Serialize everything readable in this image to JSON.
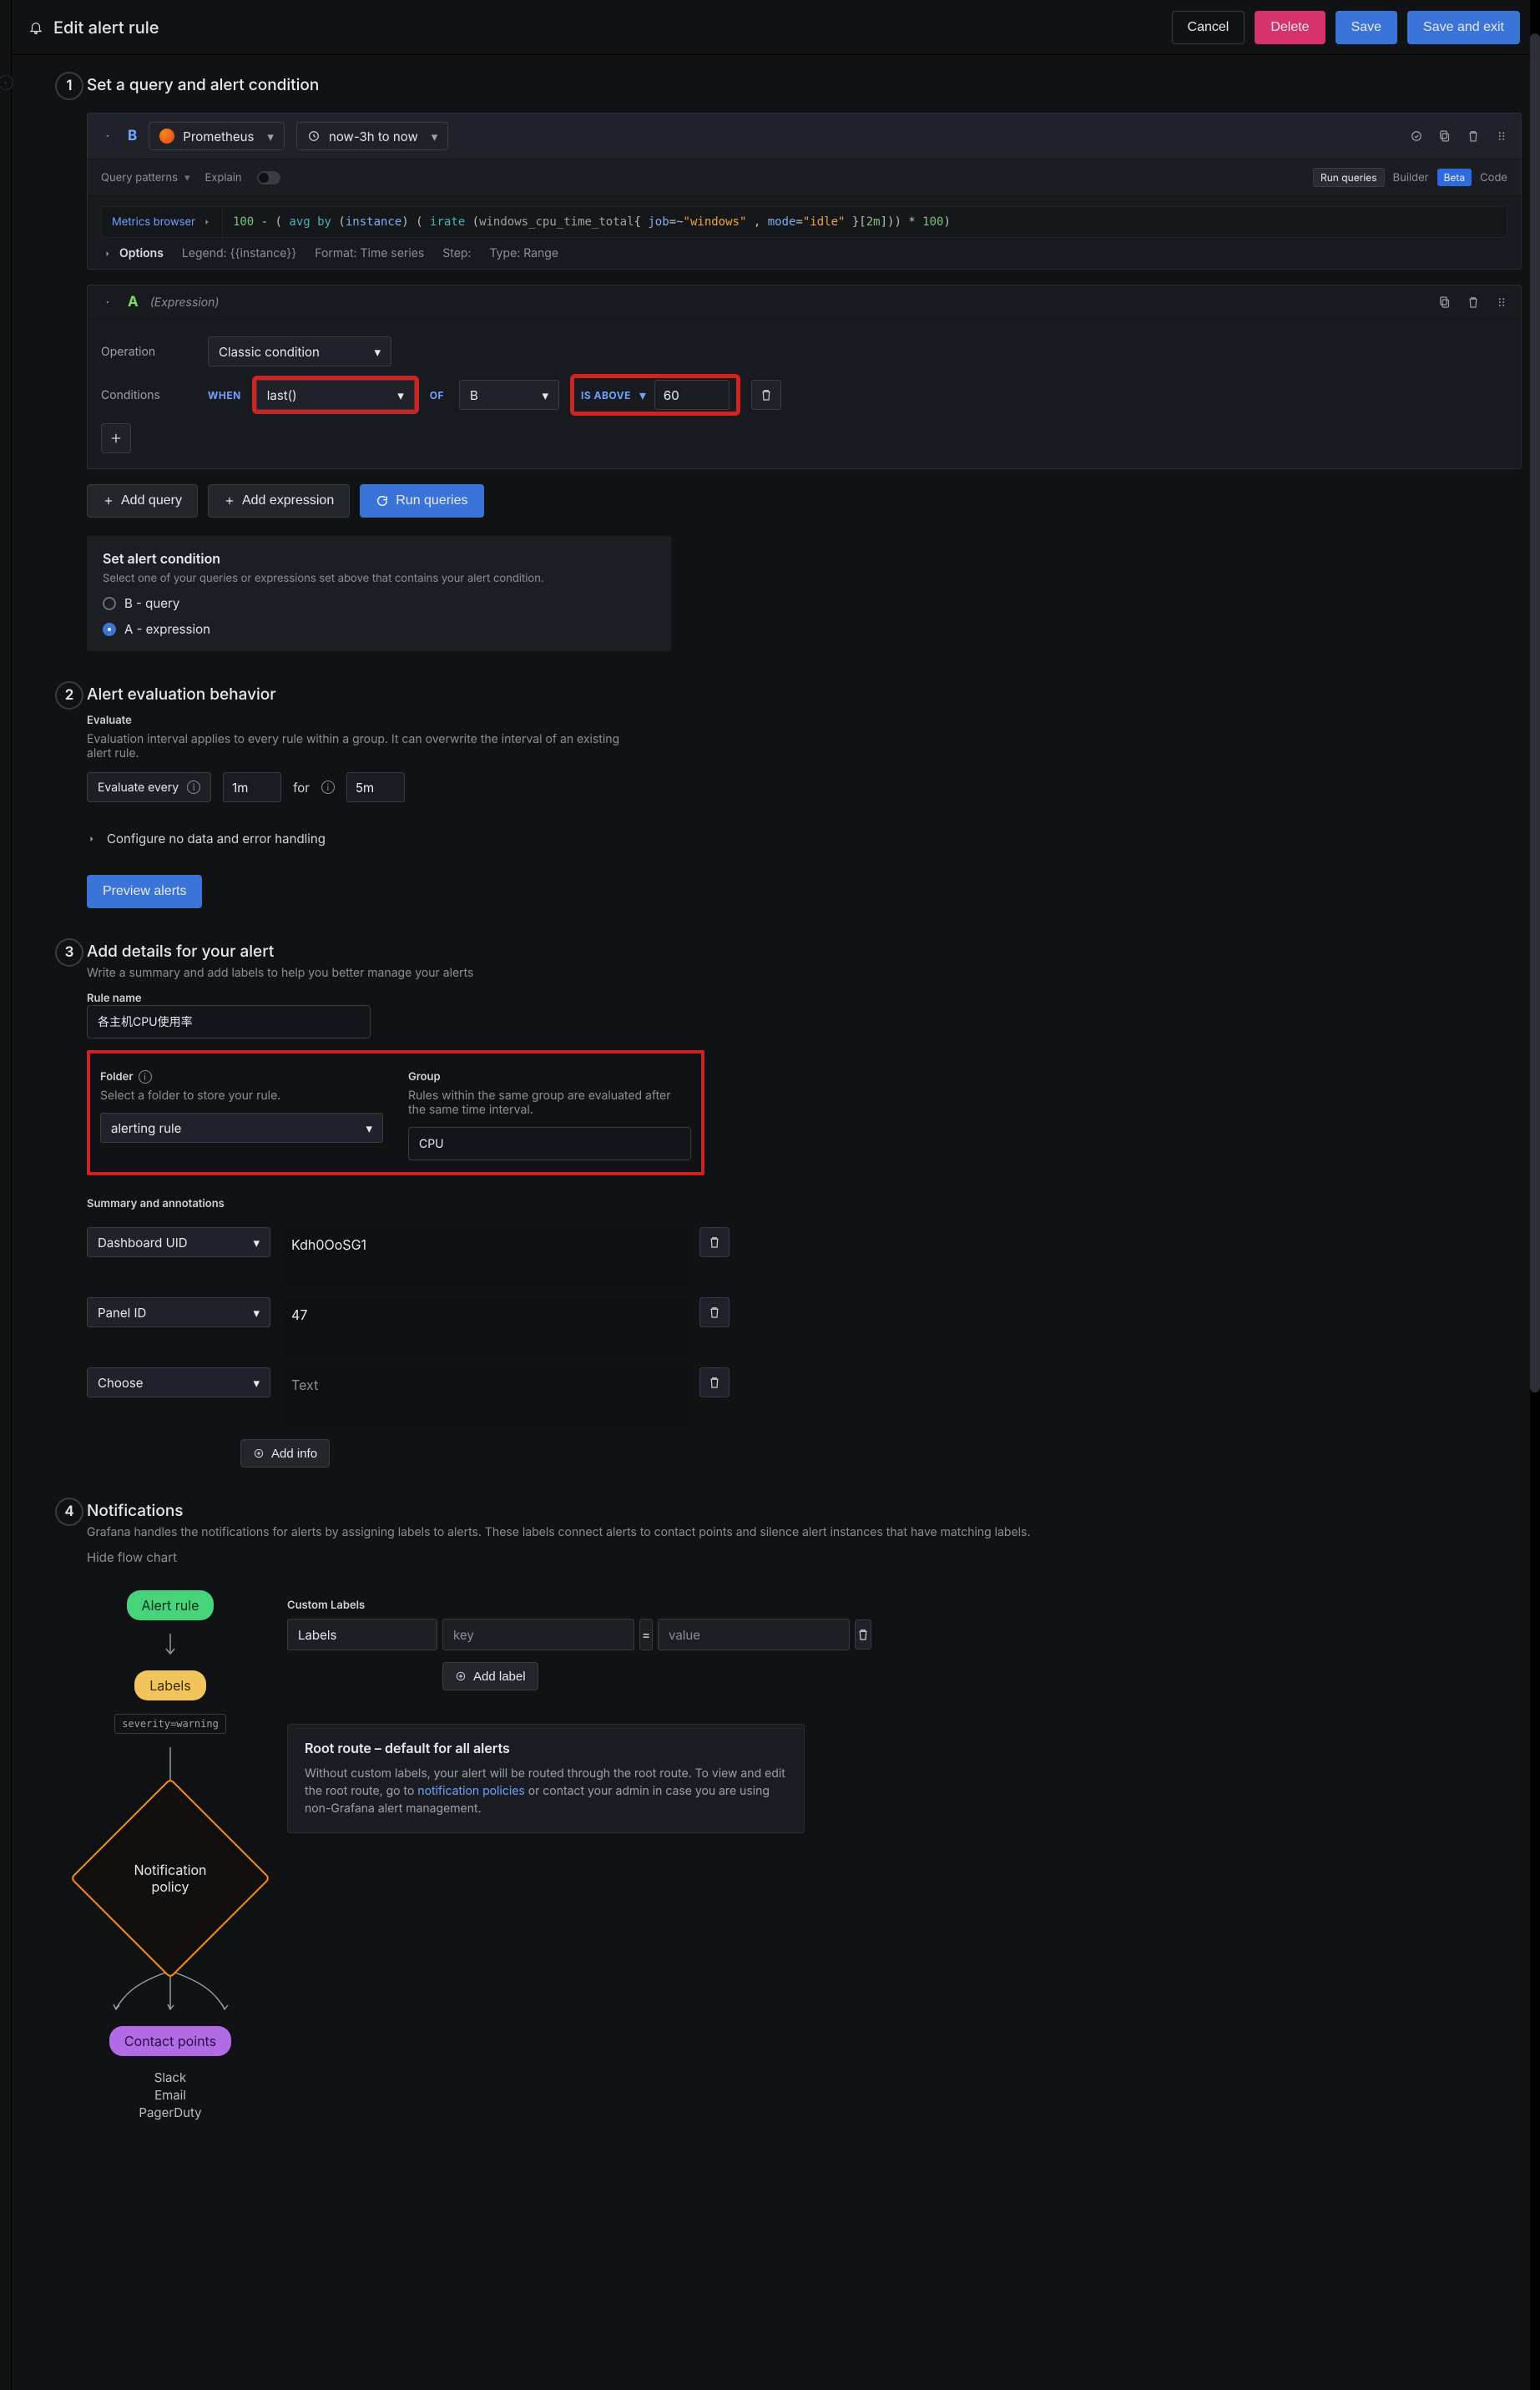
{
  "header": {
    "title": "Edit alert rule",
    "actions": {
      "cancel": "Cancel",
      "delete": "Delete",
      "save": "Save",
      "save_exit": "Save and exit"
    }
  },
  "steps": [
    {
      "num": "1",
      "title": "Set a query and alert condition"
    },
    {
      "num": "2",
      "title": "Alert evaluation behavior"
    },
    {
      "num": "3",
      "title": "Add details for your alert",
      "desc": "Write a summary and add labels to help you better manage your alerts"
    },
    {
      "num": "4",
      "title": "Notifications",
      "desc": "Grafana handles the notifications for alerts by assigning labels to alerts. These labels connect alerts to contact points and silence alert instances that have matching labels."
    }
  ],
  "query": {
    "b": {
      "name": "B",
      "datasource": "Prometheus",
      "time_range": "now-3h to now",
      "tools": {
        "patterns": "Query patterns",
        "explain": "Explain",
        "run_queries": "Run queries",
        "builder": "Builder",
        "beta": "Beta",
        "code": "Code"
      },
      "metrics_browser": "Metrics browser",
      "code": {
        "p0": "100",
        "p1": " - (",
        "p2": "avg by",
        "p3": "instance",
        "p4": "irate",
        "p5": "windows_cpu_time_total",
        "p6": "job",
        "p7": "=~",
        "p8": "\"windows\"",
        "p9": "mode",
        "p10": "=",
        "p11": "\"idle\"",
        "p12": "2m",
        "p13": "* ",
        "p14": "100"
      },
      "options": {
        "label": "Options",
        "legend": "Legend: {{instance}}",
        "format": "Format: Time series",
        "step": "Step:",
        "type": "Type: Range"
      }
    }
  },
  "expr": {
    "a": {
      "name": "A",
      "type_label": "(Expression)",
      "operation_label": "Operation",
      "operation_value": "Classic condition",
      "conditions_label": "Conditions",
      "kw": {
        "when": "WHEN",
        "of": "OF",
        "is_above": "IS ABOVE"
      },
      "when_value": "last()",
      "of_value": "B",
      "threshold": "60"
    }
  },
  "actions": {
    "add_query": "Add query",
    "add_expression": "Add expression",
    "run_queries": "Run queries"
  },
  "alert_condition": {
    "title": "Set alert condition",
    "note": "Select one of your queries or expressions set above that contains your alert condition.",
    "options": [
      "B - query",
      "A - expression"
    ]
  },
  "evaluate": {
    "heading": "Evaluate",
    "note": "Evaluation interval applies to every rule within a group. It can overwrite the interval of an existing alert rule.",
    "every_label": "Evaluate every",
    "every_value": "1m",
    "for_label": "for",
    "for_value": "5m",
    "configure_label": "Configure no data and error handling",
    "preview_btn": "Preview alerts"
  },
  "details": {
    "rule_name_label": "Rule name",
    "rule_name_value": "各主机CPU使用率",
    "folder": {
      "label": "Folder",
      "hint": "Select a folder to store your rule.",
      "value": "alerting rule"
    },
    "group": {
      "label": "Group",
      "hint": "Rules within the same group are evaluated after the same time interval.",
      "value": "CPU"
    },
    "summary_label": "Summary and annotations",
    "annotations": [
      {
        "key": "Dashboard UID",
        "value": "Kdh0OoSG1"
      },
      {
        "key": "Panel ID",
        "value": "47"
      },
      {
        "key": "Choose",
        "value": "Text",
        "placeholder": "Text"
      }
    ],
    "add_info": "Add info"
  },
  "notifications": {
    "hide_flow": "Hide flow chart",
    "flow": {
      "alert_rule": "Alert rule",
      "labels": "Labels",
      "severity_tag": "severity=warning",
      "policy": "Notification\npolicy",
      "contact_points": "Contact points",
      "contacts": [
        "Slack",
        "Email",
        "PagerDuty"
      ]
    },
    "custom_labels": {
      "title": "Custom Labels",
      "labels_label": "Labels",
      "key_placeholder": "key",
      "value_placeholder": "value",
      "add_label": "Add label"
    },
    "root_route": {
      "title": "Root route – default for all alerts",
      "text1": "Without custom labels, your alert will be routed through the root route. To view and edit the root route, go to ",
      "link": "notification policies",
      "text2": " or contact your admin in case you are using non-Grafana alert management."
    }
  }
}
